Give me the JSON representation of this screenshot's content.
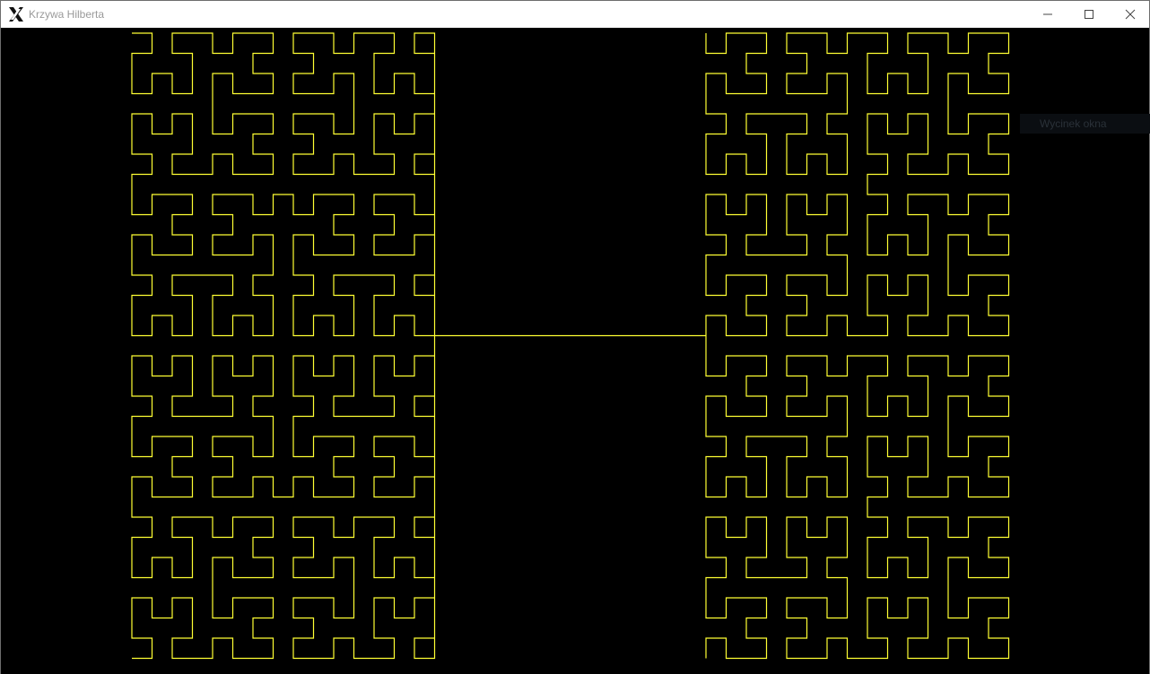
{
  "window": {
    "title": "Krzywa Hilberta",
    "app_icon": "x-logo-icon",
    "controls": {
      "minimize_icon": "minimize-icon",
      "maximize_icon": "maximize-icon",
      "close_icon": "close-icon"
    }
  },
  "canvas": {
    "background_color": "#000000",
    "curve_color": "#ffff33",
    "curve": "Hilbert curve, order 5, drawn as two joined halves",
    "order": 5
  },
  "overlay_tooltip": {
    "text": "Wycinek okna"
  }
}
